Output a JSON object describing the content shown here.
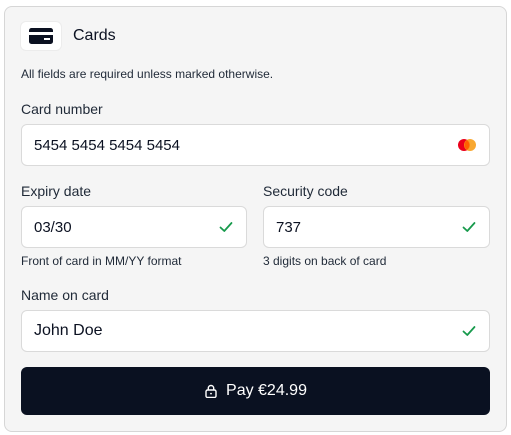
{
  "header": {
    "icon": "credit-card-icon",
    "title": "Cards"
  },
  "notice": "All fields are required unless marked otherwise.",
  "card_number": {
    "label": "Card number",
    "value": "5454 5454 5454 5454",
    "brand_icon": "mastercard-icon"
  },
  "expiry": {
    "label": "Expiry date",
    "value": "03/30",
    "hint": "Front of card in MM/YY format",
    "status_icon": "check-icon"
  },
  "security_code": {
    "label": "Security code",
    "value": "737",
    "hint": "3 digits on back of card",
    "status_icon": "check-icon"
  },
  "name_on_card": {
    "label": "Name on card",
    "value": "John Doe",
    "status_icon": "check-icon"
  },
  "pay_button": {
    "icon": "lock-icon",
    "label": "Pay €24.99"
  },
  "colors": {
    "button_bg": "#0a1121",
    "check": "#179a4c",
    "mastercard_red": "#eb001b",
    "mastercard_orange": "#f79e1b"
  }
}
